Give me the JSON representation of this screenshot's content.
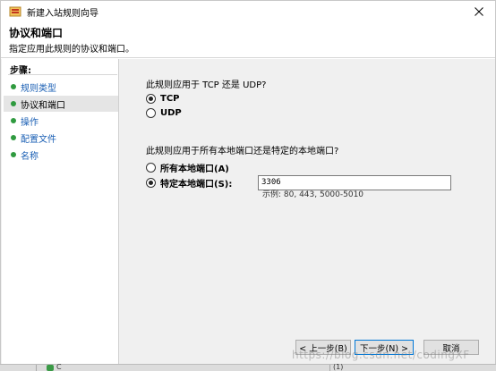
{
  "window": {
    "title": "新建入站规则向导",
    "close_icon": "close-icon",
    "app_icon": "wizard-app-icon"
  },
  "header": {
    "title": "协议和端口",
    "subtitle": "指定应用此规则的协议和端口。"
  },
  "steps": {
    "heading": "步骤:",
    "items": [
      {
        "label": "规则类型",
        "active": false
      },
      {
        "label": "协议和端口",
        "active": true
      },
      {
        "label": "操作",
        "active": false
      },
      {
        "label": "配置文件",
        "active": false
      },
      {
        "label": "名称",
        "active": false
      }
    ]
  },
  "protocol": {
    "question": "此规则应用于 TCP 还是 UDP?",
    "options": [
      {
        "label": "TCP",
        "selected": true
      },
      {
        "label": "UDP",
        "selected": false
      }
    ]
  },
  "ports": {
    "question": "此规则应用于所有本地端口还是特定的本地端口?",
    "options": [
      {
        "label": "所有本地端口(A)",
        "selected": false
      },
      {
        "label": "特定本地端口(S):",
        "selected": true
      }
    ],
    "value": "3306",
    "example": "示例: 80, 443, 5000-5010"
  },
  "buttons": {
    "back": "< 上一步(B)",
    "next": "下一步(N) >",
    "cancel": "取消"
  },
  "background_window": {
    "row_text": "C",
    "row_text2": "(1)"
  },
  "watermark": "https://blog.csdn.net/codingXF",
  "colors": {
    "step_bullet": "#2f9a3f",
    "step_link": "#1a5fb4",
    "default_button_border": "#0078d7"
  }
}
